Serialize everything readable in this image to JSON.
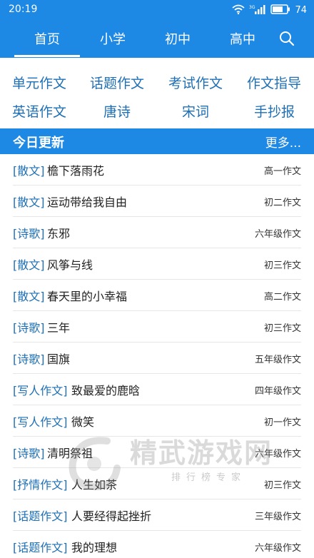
{
  "status": {
    "time": "20:19",
    "battery": "74",
    "signal_label": "3G"
  },
  "nav": {
    "tabs": [
      {
        "label": "首页"
      },
      {
        "label": "小学"
      },
      {
        "label": "初中"
      },
      {
        "label": "高中"
      }
    ],
    "active_tab": "首页"
  },
  "categories": [
    {
      "label": "单元作文"
    },
    {
      "label": "话题作文"
    },
    {
      "label": "考试作文"
    },
    {
      "label": "作文指导"
    },
    {
      "label": "英语作文"
    },
    {
      "label": "唐诗"
    },
    {
      "label": "宋词"
    },
    {
      "label": "手抄报"
    }
  ],
  "updates": {
    "title": "今日更新",
    "more": "更多..."
  },
  "articles": [
    {
      "tag": "[散文]",
      "title": "檐下落雨花",
      "grade": "高一作文"
    },
    {
      "tag": "[散文]",
      "title": "运动带给我自由",
      "grade": "初二作文"
    },
    {
      "tag": "[诗歌]",
      "title": "东邪",
      "grade": "六年级作文"
    },
    {
      "tag": "[散文]",
      "title": "风筝与线",
      "grade": "初三作文"
    },
    {
      "tag": "[散文]",
      "title": "春天里的小幸福",
      "grade": "高二作文"
    },
    {
      "tag": "[诗歌]",
      "title": "三年",
      "grade": "初三作文"
    },
    {
      "tag": "[诗歌]",
      "title": "国旗",
      "grade": "五年级作文"
    },
    {
      "tag": "[写人作文]",
      "title": "致最爱的鹿晗",
      "grade": "四年级作文"
    },
    {
      "tag": "[写人作文]",
      "title": "微笑",
      "grade": "初一作文"
    },
    {
      "tag": "[诗歌]",
      "title": "清明祭祖",
      "grade": "六年级作文"
    },
    {
      "tag": "[抒情作文]",
      "title": "人生如茶",
      "grade": "初三作文"
    },
    {
      "tag": "[话题作文]",
      "title": "人要经得起挫折",
      "grade": "三年级作文"
    },
    {
      "tag": "[话题作文]",
      "title": "我的理想",
      "grade": "六年级作文"
    }
  ],
  "watermark": {
    "main": "精武游戏网",
    "sub": "排行榜专家"
  },
  "colors": {
    "primary": "#1e88e5",
    "link": "#1e6fb5"
  }
}
